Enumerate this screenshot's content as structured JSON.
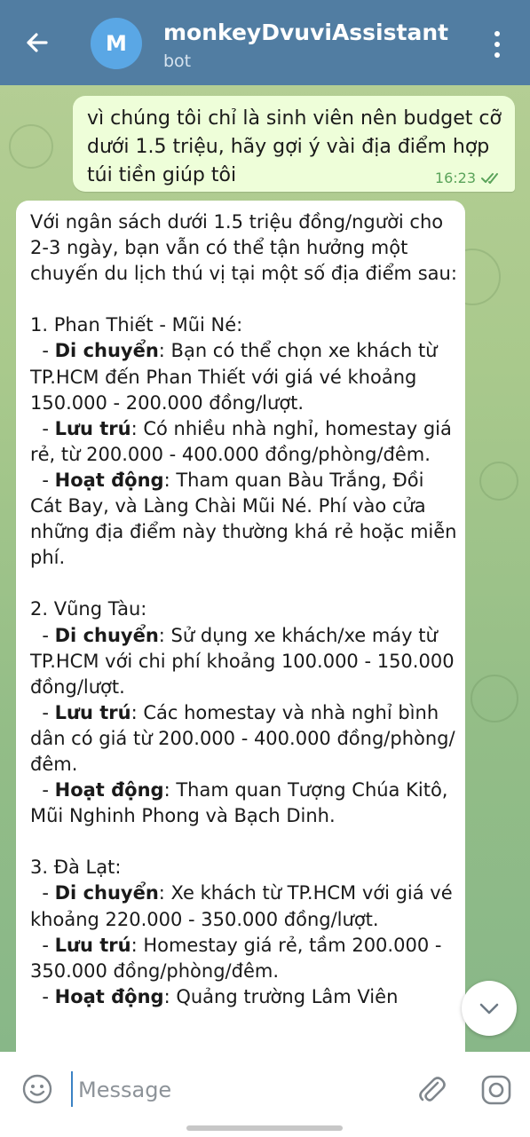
{
  "header": {
    "avatar_letter": "M",
    "title": "monkeyDvuviAssistant",
    "subtitle": "bot",
    "accent": "#517da2"
  },
  "outgoing": {
    "text": "vì chúng tôi chỉ là sinh viên nên budget cỡ dưới 1.5 triệu, hãy gợi ý vài địa điểm hợp túi tiền giúp tôi",
    "time": "16:23",
    "read": true,
    "bubble_color": "#eefed9"
  },
  "incoming": {
    "intro": "Với ngân sách dưới 1.5 triệu đồng/người cho 2-3 ngày, bạn vẫn có thể tận hưởng một chuyến du lịch thú vị tại một số địa điểm sau:",
    "places": [
      {
        "title": "1. Phan Thiết - Mũi Né:",
        "items": [
          {
            "label": "Di chuyển",
            "text": ": Bạn có thể chọn xe khách từ TP.HCM đến Phan Thiết với giá vé khoảng 150.000 - 200.000 đồng/lượt."
          },
          {
            "label": "Lưu trú",
            "text": ": Có nhiều nhà nghỉ, homestay giá rẻ, từ 200.000 - 400.000 đồng/phòng/đêm."
          },
          {
            "label": "Hoạt động",
            "text": ": Tham quan Bàu Trắng, Đồi Cát Bay, và Làng Chài Mũi Né. Phí vào cửa những địa điểm này thường khá rẻ hoặc miễn phí."
          }
        ]
      },
      {
        "title": "2. Vũng Tàu:",
        "items": [
          {
            "label": "Di chuyển",
            "text": ": Sử dụng xe khách/xe máy từ TP.HCM với chi phí khoảng 100.000 - 150.000 đồng/lượt."
          },
          {
            "label": "Lưu trú",
            "text": ": Các homestay và nhà nghỉ bình dân có giá từ 200.000 - 400.000 đồng/phòng/đêm."
          },
          {
            "label": "Hoạt động",
            "text": ": Tham quan Tượng Chúa Kitô, Mũi Nghinh Phong và Bạch Dinh."
          }
        ]
      },
      {
        "title": "3. Đà Lạt:",
        "items": [
          {
            "label": "Di chuyển",
            "text": ": Xe khách từ TP.HCM với giá vé khoảng 220.000 - 350.000 đồng/lượt."
          },
          {
            "label": "Lưu trú",
            "text": ": Homestay giá rẻ, tầm 200.000 - 350.000 đồng/phòng/đêm."
          },
          {
            "label": "Hoạt động",
            "text": ": Quảng trường Lâm Viên"
          }
        ]
      }
    ]
  },
  "icons": {
    "back": "arrow-left-icon",
    "menu": "more-vertical-icon",
    "scroll_down": "chevron-down-icon",
    "emoji": "emoji-icon",
    "attach": "paperclip-icon",
    "camera": "camera-icon"
  },
  "input": {
    "placeholder": "Message"
  }
}
